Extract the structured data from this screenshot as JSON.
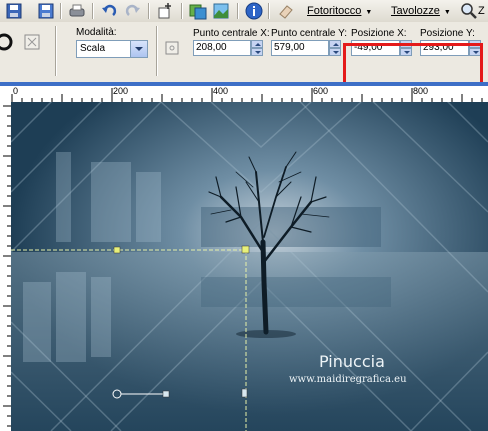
{
  "toolbar": {
    "menus": [
      {
        "label": "Fotoritocco",
        "accel": "F"
      },
      {
        "label": "Tavolozze",
        "accel": "T"
      },
      {
        "label": "Z"
      }
    ]
  },
  "tool_options": {
    "mode_label": "Modalità:",
    "mode_value": "Scala",
    "center_x_label": "Punto centrale X:",
    "center_x_value": "208,00",
    "center_y_label": "Punto centrale Y:",
    "center_y_value": "579,00",
    "pos_x_label": "Posizione X:",
    "pos_x_value": "-49,00",
    "pos_y_label": "Posizione Y:",
    "pos_y_value": "293,00"
  },
  "ruler": {
    "h_labels": [
      "0",
      "200",
      "400",
      "600",
      "800"
    ]
  },
  "canvas": {
    "watermark_name": "Pinuccia",
    "watermark_url": "www.maidiregrafica.eu"
  }
}
